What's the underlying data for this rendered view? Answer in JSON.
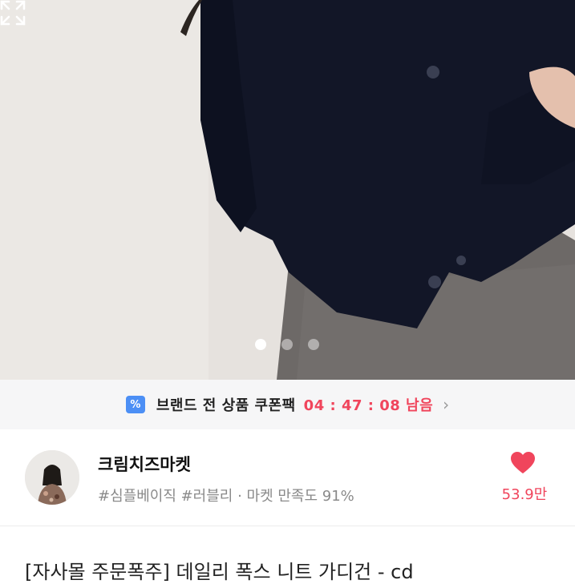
{
  "carousel": {
    "page_count": 3,
    "active_index": 0
  },
  "coupon": {
    "icon": "coupon-percent-icon",
    "icon_glyph": "%",
    "label": "브랜드 전 상품 쿠폰팩",
    "timer": "04 : 47 : 08 남음",
    "chevron": "›"
  },
  "shop": {
    "name": "크림치즈마켓",
    "tags": "#심플베이직 #러블리 · 마켓 만족도 91%",
    "likes": "53.9만"
  },
  "product": {
    "title": "[자사몰 주문폭주] 데일리 폭스 니트 가디건 - cd"
  },
  "colors": {
    "accent": "#f0455c",
    "coupon_icon": "#4c8ff5"
  }
}
